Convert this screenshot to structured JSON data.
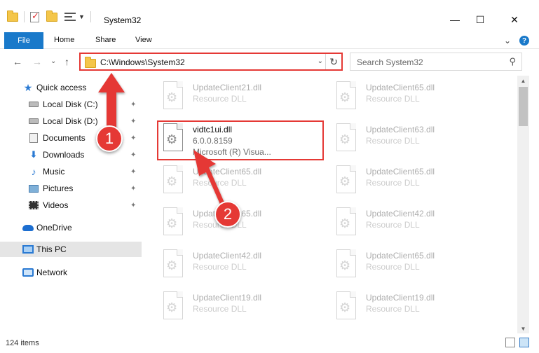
{
  "window": {
    "title": "System32",
    "minimize": "—",
    "maximize": "☐",
    "close": "✕"
  },
  "ribbon": {
    "file": "File",
    "home": "Home",
    "share": "Share",
    "view": "View",
    "collapse": "⌄",
    "help": "?"
  },
  "nav": {
    "back": "←",
    "forward": "→",
    "history": "⌄",
    "up": "↑"
  },
  "address": {
    "path": "C:\\Windows\\System32",
    "dropdown": "⌄",
    "refresh": "↻"
  },
  "search": {
    "placeholder": "Search System32"
  },
  "sidebar": {
    "items": [
      {
        "label": "Quick access",
        "icon": "star-icon"
      },
      {
        "label": "Local Disk (C:)",
        "icon": "drive-icon",
        "pinned": true
      },
      {
        "label": "Local Disk (D:)",
        "icon": "drive-icon",
        "pinned": true
      },
      {
        "label": "Documents",
        "icon": "documents-icon",
        "pinned": true
      },
      {
        "label": "Downloads",
        "icon": "downloads-icon",
        "pinned": true
      },
      {
        "label": "Music",
        "icon": "music-icon",
        "pinned": true
      },
      {
        "label": "Pictures",
        "icon": "pictures-icon",
        "pinned": true
      },
      {
        "label": "Videos",
        "icon": "videos-icon",
        "pinned": true
      },
      {
        "label": "OneDrive",
        "icon": "onedrive-icon"
      },
      {
        "label": "This PC",
        "icon": "this-pc-icon",
        "selected": true
      },
      {
        "label": "Network",
        "icon": "network-icon"
      }
    ],
    "pin_glyph": "📌"
  },
  "files": {
    "left": [
      {
        "name": "UpdateClient21.dll",
        "desc": "Resource DLL"
      },
      {
        "name": "vidtc1ui.dll",
        "desc": "6.0.0.8159",
        "desc2": "Microsoft (R) Visua...",
        "highlight": true
      },
      {
        "name": "UpdateClient65.dll",
        "desc": "Resource DLL"
      },
      {
        "name": "UpdateClient65.dll",
        "desc": "Resource DLL"
      },
      {
        "name": "UpdateClient42.dll",
        "desc": "Resource DLL"
      },
      {
        "name": "UpdateClient19.dll",
        "desc": "Resource DLL"
      }
    ],
    "right": [
      {
        "name": "UpdateClient65.dll",
        "desc": "Resource DLL"
      },
      {
        "name": "UpdateClient63.dll",
        "desc": "Resource DLL"
      },
      {
        "name": "UpdateClient65.dll",
        "desc": "Resource DLL"
      },
      {
        "name": "UpdateClient42.dll",
        "desc": "Resource DLL"
      },
      {
        "name": "UpdateClient65.dll",
        "desc": "Resource DLL"
      },
      {
        "name": "UpdateClient19.dll",
        "desc": "Resource DLL"
      }
    ]
  },
  "status": {
    "count": "124 items"
  },
  "annotations": {
    "step1": "1",
    "step2": "2",
    "color": "#e53935"
  },
  "colors": {
    "accent": "#1979ca",
    "highlight_red": "#e53935"
  }
}
